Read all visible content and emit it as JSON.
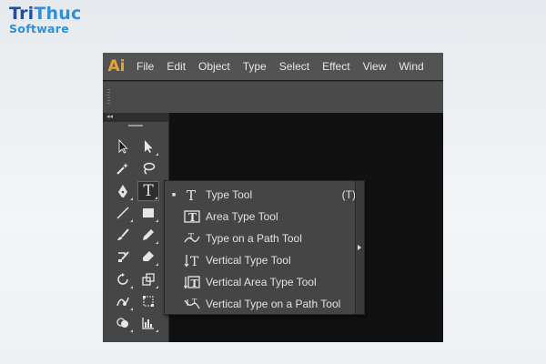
{
  "watermark": {
    "line1_a": "Tri",
    "line1_b": "Thuc",
    "line2": "Software"
  },
  "app": {
    "logo": "Ai"
  },
  "menu": {
    "items": [
      "File",
      "Edit",
      "Object",
      "Type",
      "Select",
      "Effect",
      "View",
      "Wind"
    ]
  },
  "toolbox": {
    "collapse": "◂◂",
    "tools": [
      {
        "name": "selection-tool",
        "icon": "arrow-icon"
      },
      {
        "name": "direct-selection-tool",
        "icon": "hollow-arrow-icon"
      },
      {
        "name": "magic-wand-tool",
        "icon": "magic-wand-icon"
      },
      {
        "name": "lasso-tool",
        "icon": "lasso-icon"
      },
      {
        "name": "pen-tool",
        "icon": "pen-icon"
      },
      {
        "name": "type-tool",
        "icon": "type-icon",
        "glyph": "T"
      },
      {
        "name": "line-segment-tool",
        "icon": "line-icon"
      },
      {
        "name": "rectangle-tool",
        "icon": "rectangle-icon"
      },
      {
        "name": "paintbrush-tool",
        "icon": "brush-icon"
      },
      {
        "name": "pencil-tool",
        "icon": "pencil-icon"
      },
      {
        "name": "blob-brush-tool",
        "icon": "blob-brush-icon"
      },
      {
        "name": "eraser-tool",
        "icon": "eraser-icon"
      },
      {
        "name": "rotate-tool",
        "icon": "rotate-icon"
      },
      {
        "name": "scale-tool",
        "icon": "scale-icon"
      },
      {
        "name": "warp-tool",
        "icon": "warp-icon"
      },
      {
        "name": "free-transform-tool",
        "icon": "free-transform-icon"
      },
      {
        "name": "shape-builder-tool",
        "icon": "shape-builder-icon"
      },
      {
        "name": "graph-tool",
        "icon": "graph-icon"
      }
    ]
  },
  "flyout": {
    "items": [
      {
        "label": "Type Tool",
        "shortcut": "(T)",
        "selected": true,
        "icon": "type-icon"
      },
      {
        "label": "Area Type Tool",
        "shortcut": "",
        "selected": false,
        "icon": "area-type-icon"
      },
      {
        "label": "Type on a Path Tool",
        "shortcut": "",
        "selected": false,
        "icon": "type-on-path-icon"
      },
      {
        "label": "Vertical Type Tool",
        "shortcut": "",
        "selected": false,
        "icon": "vertical-type-icon"
      },
      {
        "label": "Vertical Area Type Tool",
        "shortcut": "",
        "selected": false,
        "icon": "vertical-area-type-icon"
      },
      {
        "label": "Vertical Type on a Path Tool",
        "shortcut": "",
        "selected": false,
        "icon": "vertical-type-on-path-icon"
      }
    ],
    "selected_marker": "■"
  },
  "colors": {
    "accent": "#e7a33b",
    "menubar": "#535353",
    "panel": "#464646",
    "canvas": "#111111",
    "watermark_dark": "#1f4ea3",
    "watermark_light": "#2f8fd8"
  }
}
